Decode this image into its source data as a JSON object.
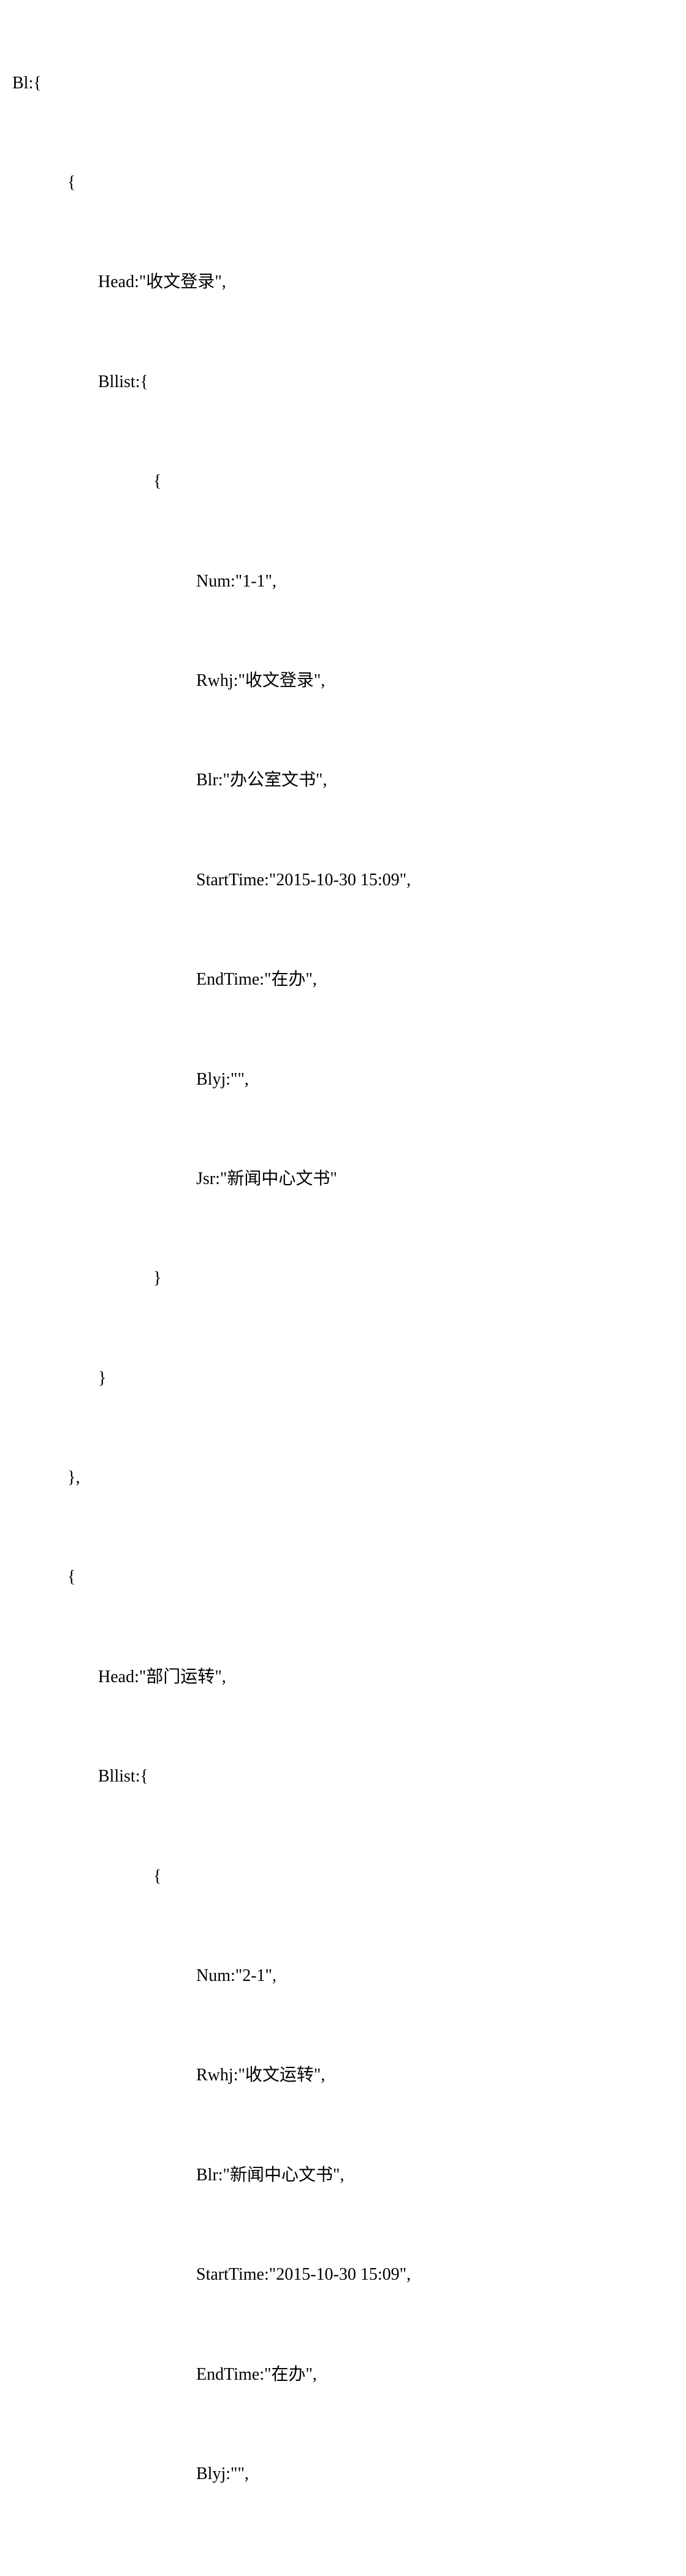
{
  "code": {
    "root_key": "Bl",
    "group1": {
      "head_key": "Head",
      "head_val": "收文登录",
      "list_key": "Bllist",
      "item": {
        "num_key": "Num",
        "num_val": "1-1",
        "rwhj_key": "Rwhj",
        "rwhj_val": "收文登录",
        "blr_key": "Blr",
        "blr_val": "办公室文书",
        "starttime_key": "StartTime",
        "starttime_val": "2015-10-30 15:09",
        "endtime_key": "EndTime",
        "endtime_val": "在办",
        "blyj_key": "Blyj",
        "blyj_val": "",
        "jsr_key": "Jsr",
        "jsr_val": "新闻中心文书"
      }
    },
    "group2": {
      "head_key": "Head",
      "head_val": "部门运转",
      "list_key": "Bllist",
      "item": {
        "num_key": "Num",
        "num_val": "2-1",
        "rwhj_key": "Rwhj",
        "rwhj_val": "收文运转",
        "blr_key": "Blr",
        "blr_val": "新闻中心文书",
        "starttime_key": "StartTime",
        "starttime_val": "2015-10-30 15:09",
        "endtime_key": "EndTime",
        "endtime_val": "在办",
        "blyj_key": "Blyj",
        "blyj_val": ""
      }
    }
  },
  "punct": {
    "open_brace": "{",
    "close_brace": "}",
    "close_brace_comma": "},",
    "colon_open": ":{",
    "comma": ",",
    "quote_open": ":\"",
    "quote_close": "\"",
    "quote_close_comma": "\","
  }
}
